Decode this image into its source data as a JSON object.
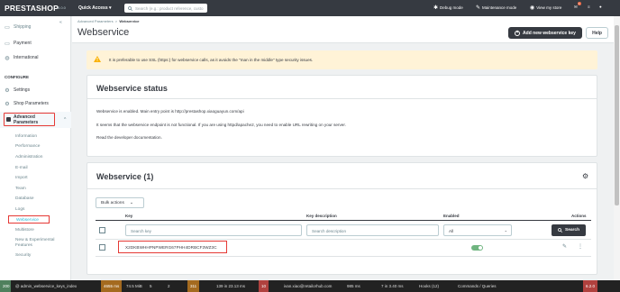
{
  "topbar": {
    "logo": "PRESTASHOP",
    "version": "8.0.0",
    "quick_access": "Quick Access",
    "search_placeholder": "Search (e.g.: product reference, custo",
    "debug_mode": "Debug mode",
    "maintenance_mode": "Maintenance mode",
    "view_my_store": "View my store",
    "notif_count": "1"
  },
  "sidebar": {
    "items_top": [
      {
        "label": "Shipping",
        "icon": "truck-icon"
      },
      {
        "label": "Payment",
        "icon": "card-icon"
      },
      {
        "label": "International",
        "icon": "globe-icon"
      }
    ],
    "configure_heading": "CONFIGURE",
    "items_configure": [
      {
        "label": "Settings",
        "icon": "gear-icon"
      },
      {
        "label": "Shop Parameters",
        "icon": "gear-icon"
      }
    ],
    "advanced": "Advanced Parameters",
    "subitems": [
      "Information",
      "Performance",
      "Administration",
      "E-mail",
      "Import",
      "Team",
      "Database",
      "Logs"
    ],
    "active_subitem": "Webservice",
    "subitems_after": [
      "Multistore",
      "New & Experimental Features",
      "Security"
    ]
  },
  "header": {
    "breadcrumb_parent": "Advanced Parameters",
    "breadcrumb_current": "Webservice",
    "title": "Webservice",
    "add_button": "Add new webservice key",
    "help_button": "Help"
  },
  "alert": {
    "text": "It is preferable to use SSL (https:) for webservice calls, as it avoids the \"man in the middle\" type security issues."
  },
  "status": {
    "title": "Webservice status",
    "line1": "Webservice is enabled. Main entry point is http://prestashop.xiaoguayun.com/api",
    "line2": "It seems that the webservice endpoint is not functional. If you are using httpd/apache2, you need to enable URL rewriting on your server.",
    "line3": "Read the developer documentation."
  },
  "list": {
    "title": "Webservice (1)",
    "bulk_actions": "Bulk actions",
    "columns": {
      "key": "Key",
      "description": "Key description",
      "enabled": "Enabled",
      "actions": "Actions"
    },
    "filters": {
      "key_placeholder": "Search key",
      "description_placeholder": "Search description",
      "enabled_value": "All",
      "search_button": "Search"
    },
    "rows": [
      {
        "key": "X2DKBWHHPNPWERG67PHH4DRBCF3WZ3C",
        "description": "",
        "enabled": true
      }
    ]
  },
  "debugbar": {
    "status": "200",
    "route": "@ admin_webservice_keys_index",
    "memory": "4655 ms",
    "mem2": "74.5 MiB",
    "count1": "5",
    "count2": "2",
    "count3": "311",
    "time": "139 in 23.13 ms",
    "count4": "10",
    "user": "ivan.xiao@retailorhub.com",
    "ms": "985 ms",
    "twig": "7 in 3.40 ms",
    "hooks": "Hooks (12)",
    "commands": "Commands / Queries",
    "sf_version": "6.2.0"
  },
  "colors": {
    "dark": "#363a41",
    "accent": "#25b9d7",
    "highlight": "#e53935",
    "success": "#70b580"
  }
}
